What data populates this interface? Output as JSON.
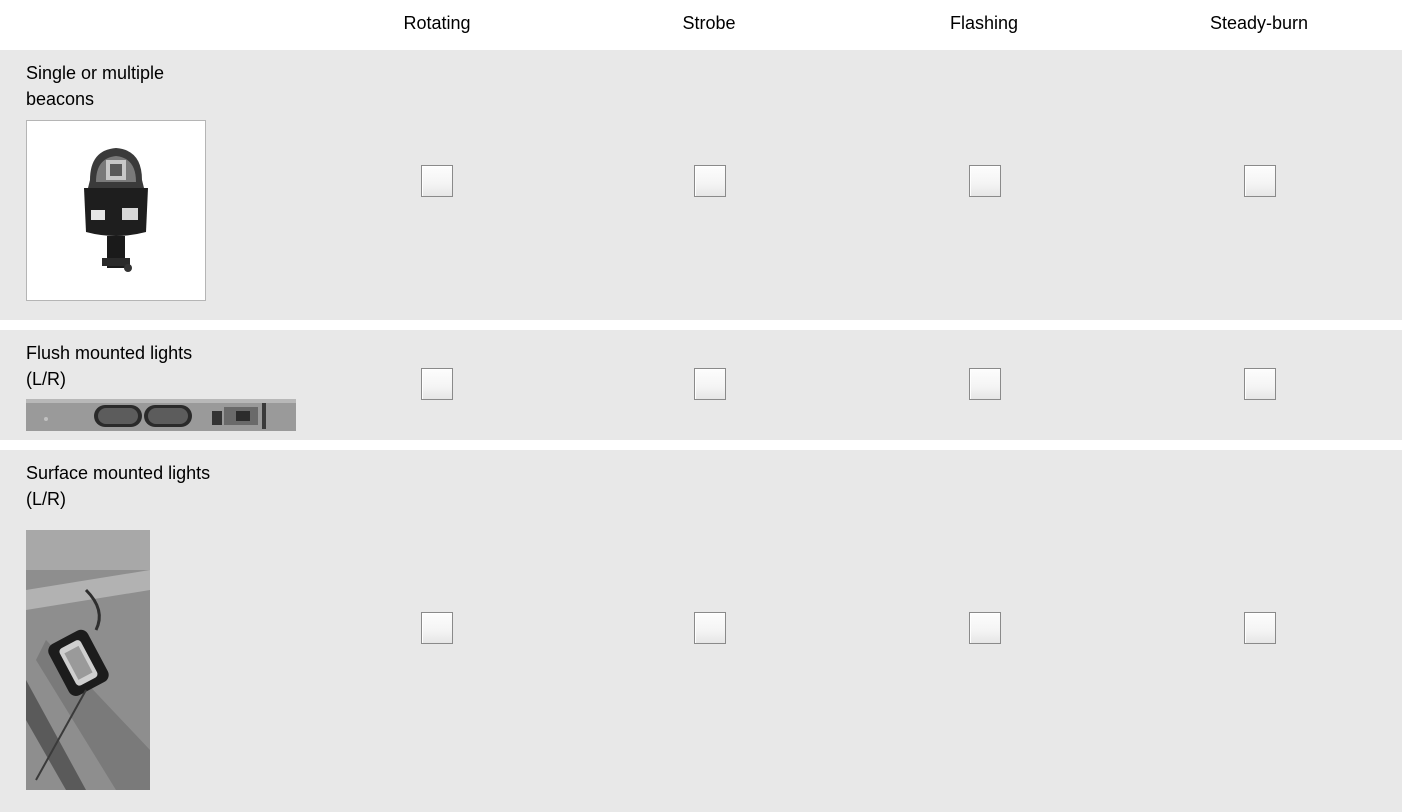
{
  "columns": [
    "Rotating",
    "Strobe",
    "Flashing",
    "Steady-burn"
  ],
  "rows": [
    {
      "label": "Single or multiple\nbeacons",
      "image": "rotating-beacon-photo",
      "checked": [
        false,
        false,
        false,
        false
      ]
    },
    {
      "label": "Flush mounted lights\n(L/R)",
      "image": "flush-mounted-lights-photo",
      "checked": [
        false,
        false,
        false,
        false
      ]
    },
    {
      "label": "Surface mounted lights\n(L/R)",
      "image": "surface-mounted-light-photo",
      "checked": [
        false,
        false,
        false,
        false
      ]
    }
  ]
}
